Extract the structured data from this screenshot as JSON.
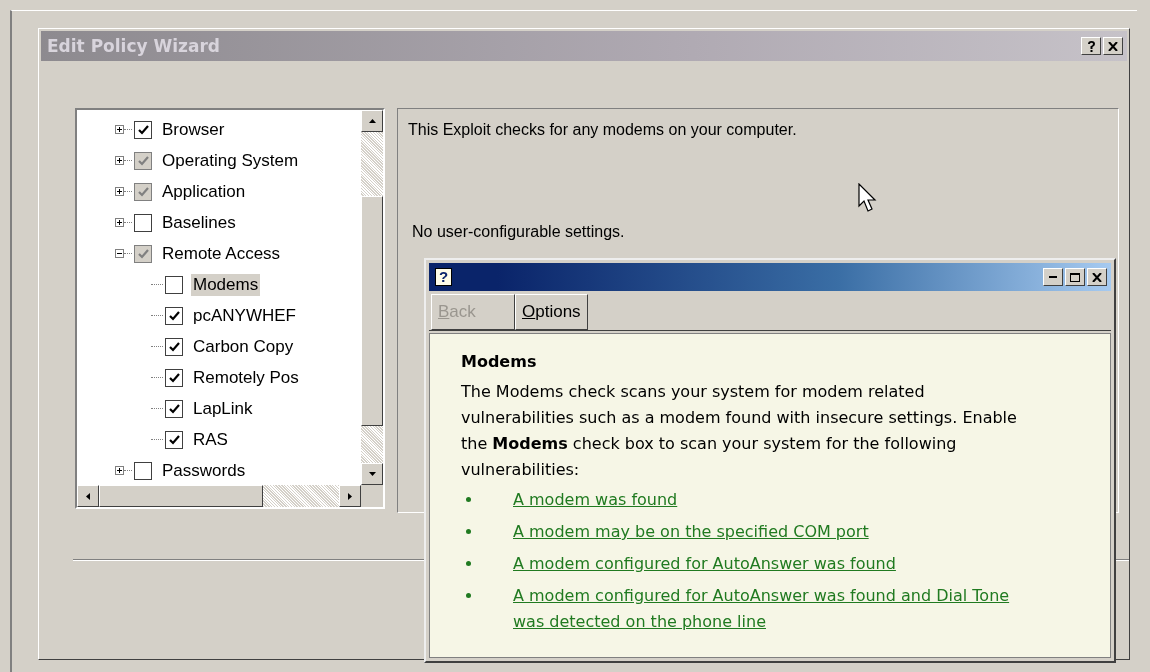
{
  "window": {
    "title": "Edit Policy Wizard"
  },
  "tree": [
    {
      "label": "Browser",
      "expanded": false,
      "checked": true,
      "indeterminate": false,
      "selected": false
    },
    {
      "label": "Operating System",
      "expanded": false,
      "checked": true,
      "indeterminate": true,
      "selected": false
    },
    {
      "label": "Application",
      "expanded": false,
      "checked": true,
      "indeterminate": true,
      "selected": false
    },
    {
      "label": "Baselines",
      "expanded": false,
      "checked": false,
      "indeterminate": false,
      "selected": false
    },
    {
      "label": "Remote Access",
      "expanded": true,
      "checked": true,
      "indeterminate": true,
      "selected": false,
      "children": [
        {
          "label": "Modems",
          "checked": false,
          "indeterminate": false,
          "selected": true
        },
        {
          "label": "pcANYWHEF",
          "checked": true,
          "indeterminate": false,
          "selected": false
        },
        {
          "label": "Carbon Copy",
          "checked": true,
          "indeterminate": false,
          "selected": false
        },
        {
          "label": "Remotely Pos",
          "checked": true,
          "indeterminate": false,
          "selected": false
        },
        {
          "label": "LapLink",
          "checked": true,
          "indeterminate": false,
          "selected": false
        },
        {
          "label": "RAS",
          "checked": true,
          "indeterminate": false,
          "selected": false
        }
      ]
    },
    {
      "label": "Passwords",
      "expanded": false,
      "checked": false,
      "indeterminate": false,
      "selected": false
    }
  ],
  "details": {
    "description": "This Exploit checks for any modems on your computer.",
    "settings": "No user-configurable settings."
  },
  "help_window": {
    "title_icon": "?",
    "toolbar": [
      {
        "label": "Back",
        "disabled": true
      },
      {
        "label": "Options",
        "disabled": false
      }
    ],
    "heading": "Modems",
    "body": "The Modems check scans your system for modem related vulnerabilities such as a modem found with insecure settings.  Enable the **Modems** check box to scan your system for the following vulnerabilities:",
    "links": [
      "A modem was found",
      "A modem may be on the specified COM port",
      "A modem configured for AutoAnswer was found",
      "A modem configured for AutoAnswer was found and Dial Tone was detected on the phone line"
    ]
  }
}
